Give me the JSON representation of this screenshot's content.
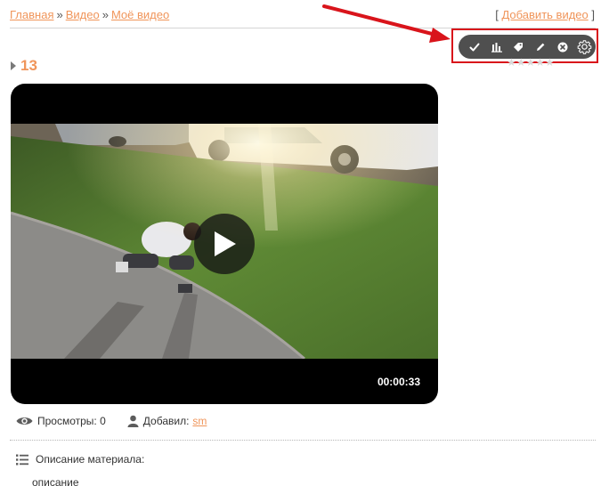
{
  "breadcrumb": {
    "items": [
      "Главная",
      "Видео",
      "Моё видео"
    ],
    "separator": "»"
  },
  "add_video": {
    "bracket_open": "[",
    "label": "Добавить видео",
    "bracket_close": "]"
  },
  "entry": {
    "title": "13"
  },
  "admin_toolbar": {
    "buttons": [
      "check-icon",
      "stats-icon",
      "tag-icon",
      "edit-pencil-icon",
      "delete-icon",
      "gear-icon"
    ]
  },
  "rating": {
    "stars": "★★★★★"
  },
  "player": {
    "duration": "00:00:33"
  },
  "meta": {
    "views_label": "Просмотры: 0",
    "added_label": "Добавил:",
    "author": "sm"
  },
  "description": {
    "heading": "Описание материала:",
    "text": "описание"
  },
  "colors": {
    "link": "#f0955a",
    "highlight": "#d9141b",
    "toolbar_bg": "#4f4f4f"
  }
}
